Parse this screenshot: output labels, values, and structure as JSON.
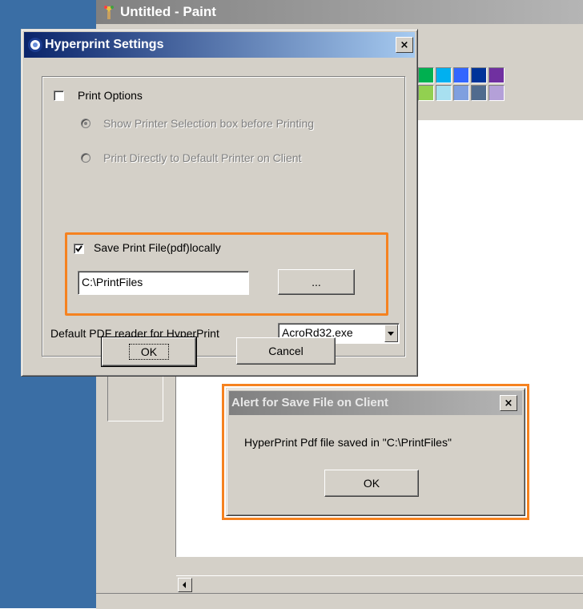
{
  "paint_window": {
    "title": "Untitled - Paint"
  },
  "palette": {
    "row1": [
      "#00b050",
      "#00b0f0",
      "#3366ff",
      "#003399",
      "#7030a0"
    ],
    "row2": [
      "#92d050",
      "#a8e0f0",
      "#7f9fdf",
      "#506b8e",
      "#b4a0d8"
    ]
  },
  "settings_dialog": {
    "title": "Hyperprint Settings",
    "close_label": "×",
    "print_options_label": "Print Options",
    "print_options_checked": false,
    "radio_show_selection_label": "Show Printer Selection box before Printing",
    "radio_print_direct_label": "Print Directly to Default Printer on Client",
    "save_locally_label": "Save Print File(pdf)locally",
    "save_locally_checked": true,
    "save_path_value": "C:\\PrintFiles",
    "browse_label": "...",
    "pdf_reader_label": "Default PDF reader for HyperPrint",
    "pdf_reader_value": "AcroRd32.exe",
    "ok_label": "OK",
    "cancel_label": "Cancel"
  },
  "alert_dialog": {
    "title": "Alert for Save File on Client",
    "close_label": "×",
    "message": "HyperPrint Pdf file saved in \"C:\\PrintFiles\"",
    "ok_label": "OK"
  },
  "colors": {
    "highlight": "#f58220",
    "active_title": "#0a246a",
    "inactive_title": "#808080",
    "face": "#d4d0c8",
    "desktop": "#3a6ea5"
  }
}
